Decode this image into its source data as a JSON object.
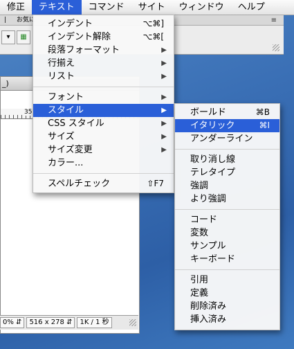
{
  "menubar": {
    "items": [
      "修正",
      "テキスト",
      "コマンド",
      "サイト",
      "ウィンドウ",
      "ヘルプ"
    ],
    "active_index": 1
  },
  "background": {
    "tab_label": "お気に",
    "doc_title_fragment": "_)",
    "ruler_label": "35",
    "status": {
      "zoom": "0%",
      "size": "516 x 278",
      "download": "1K / 1 秒"
    }
  },
  "text_menu": {
    "groups": [
      [
        {
          "label": "インデント",
          "shortcut": "⌥⌘]"
        },
        {
          "label": "インデント解除",
          "shortcut": "⌥⌘["
        },
        {
          "label": "段落フォーマット",
          "submenu": true
        },
        {
          "label": "行揃え",
          "submenu": true
        },
        {
          "label": "リスト",
          "submenu": true
        }
      ],
      [
        {
          "label": "フォント",
          "submenu": true
        },
        {
          "label": "スタイル",
          "submenu": true,
          "selected": true
        },
        {
          "label": "CSS スタイル",
          "submenu": true
        },
        {
          "label": "サイズ",
          "submenu": true
        },
        {
          "label": "サイズ変更",
          "submenu": true
        },
        {
          "label": "カラー..."
        }
      ],
      [
        {
          "label": "スペルチェック",
          "shortcut": "⇧F7"
        }
      ]
    ]
  },
  "style_menu": {
    "groups": [
      [
        {
          "label": "ボールド",
          "shortcut": "⌘B"
        },
        {
          "label": "イタリック",
          "shortcut": "⌘I",
          "selected": true
        },
        {
          "label": "アンダーライン"
        }
      ],
      [
        {
          "label": "取り消し線"
        },
        {
          "label": "テレタイプ"
        },
        {
          "label": "強調"
        },
        {
          "label": "より強調"
        }
      ],
      [
        {
          "label": "コード"
        },
        {
          "label": "変数"
        },
        {
          "label": "サンプル"
        },
        {
          "label": "キーボード"
        }
      ],
      [
        {
          "label": "引用"
        },
        {
          "label": "定義"
        },
        {
          "label": "削除済み"
        },
        {
          "label": "挿入済み"
        }
      ]
    ]
  },
  "colors": {
    "highlight": "#2a5fd8",
    "desktop": "#3a6fb5"
  }
}
